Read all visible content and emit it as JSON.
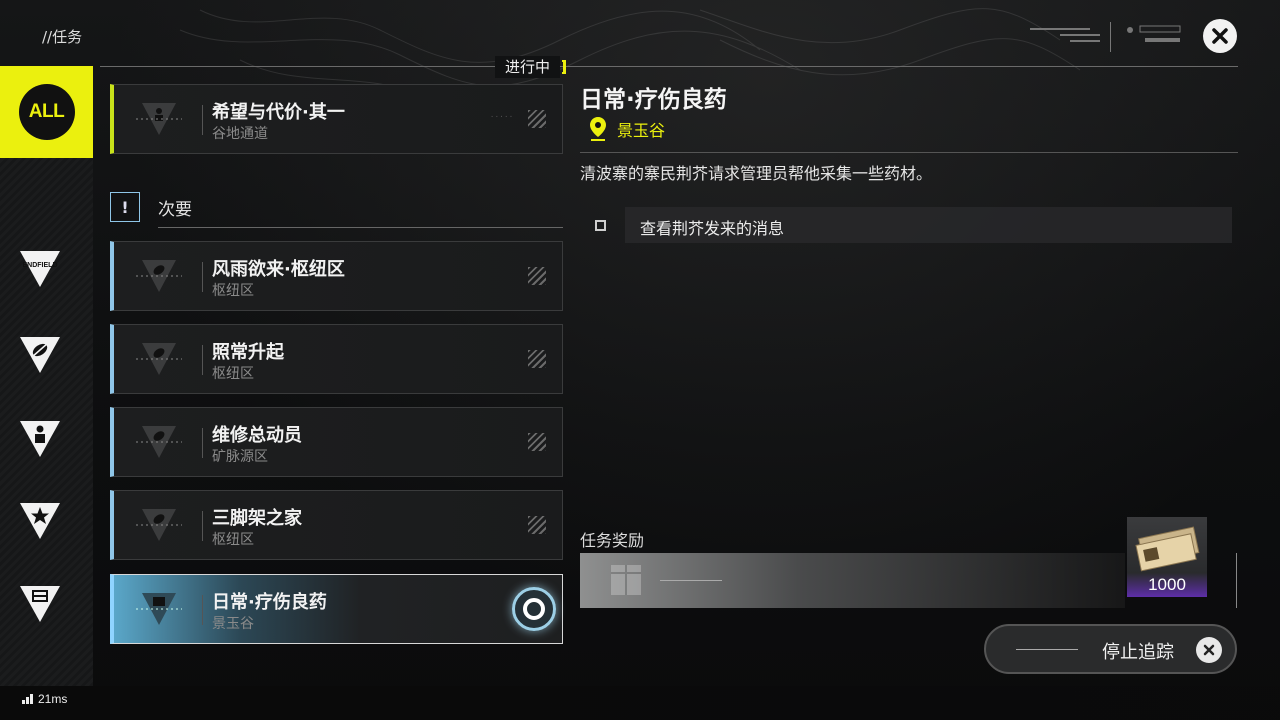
{
  "header": {
    "breadcrumb": "//任务",
    "in_progress_label": "进行中"
  },
  "sidebar": {
    "items": [
      {
        "name": "all",
        "label": "ALL",
        "active": true
      },
      {
        "name": "endfield",
        "label": "ENDFIELD",
        "active": false
      },
      {
        "name": "leaf",
        "label": "",
        "active": false
      },
      {
        "name": "person",
        "label": "",
        "active": false
      },
      {
        "name": "star",
        "label": "",
        "active": false
      },
      {
        "name": "battery",
        "label": "",
        "active": false
      }
    ]
  },
  "quests": {
    "main": {
      "title": "希望与代价·其一",
      "location": "谷地通道"
    },
    "section_label": "次要",
    "section_icon": "!",
    "side": [
      {
        "title": "风雨欲来·枢纽区",
        "location": "枢纽区"
      },
      {
        "title": "照常升起",
        "location": "枢纽区"
      },
      {
        "title": "维修总动员",
        "location": "矿脉源区"
      },
      {
        "title": "三脚架之家",
        "location": "枢纽区"
      },
      {
        "title": "日常·疗伤良药",
        "location": "景玉谷",
        "selected": true
      }
    ]
  },
  "detail": {
    "title": "日常·疗伤良药",
    "location": "景玉谷",
    "description": "清波寨的寨民荆芥请求管理员帮他采集一些药材。",
    "objective": "查看荆芥发来的消息",
    "reward_label": "任务奖励",
    "reward_qty": "1000",
    "stop_tracking": "停止追踪"
  },
  "status": {
    "ping": "21ms"
  },
  "colors": {
    "accent_yellow": "#ebf00e",
    "side_quest_blue": "#8fc6e8",
    "rarity_purple": "#5d2ea8"
  }
}
